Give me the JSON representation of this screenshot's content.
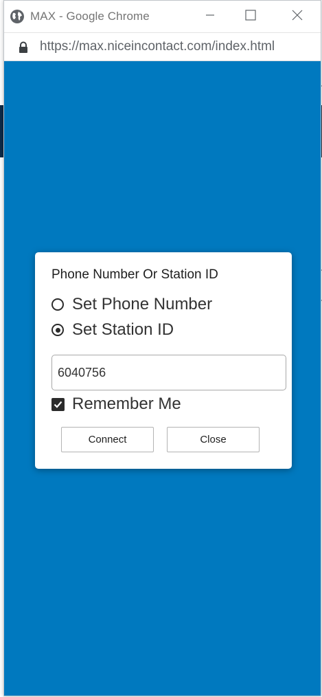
{
  "window": {
    "title": "MAX - Google Chrome",
    "url": "https://max.niceincontact.com/index.html",
    "icons": [
      "globe-icon",
      "minimize-icon",
      "maximize-icon",
      "close-icon",
      "lock-icon"
    ]
  },
  "colors": {
    "viewport_bg": "#0079bf",
    "dialog_bg": "#ffffff",
    "dark_band": "#0e2a47"
  },
  "dialog": {
    "title": "Phone Number Or Station ID",
    "options": [
      {
        "label": "Set Phone Number",
        "selected": false
      },
      {
        "label": "Set Station ID",
        "selected": true
      }
    ],
    "station_input_value": "6040756",
    "remember_me_label": "Remember Me",
    "remember_me_checked": true,
    "connect_label": "Connect",
    "close_label": "Close"
  }
}
